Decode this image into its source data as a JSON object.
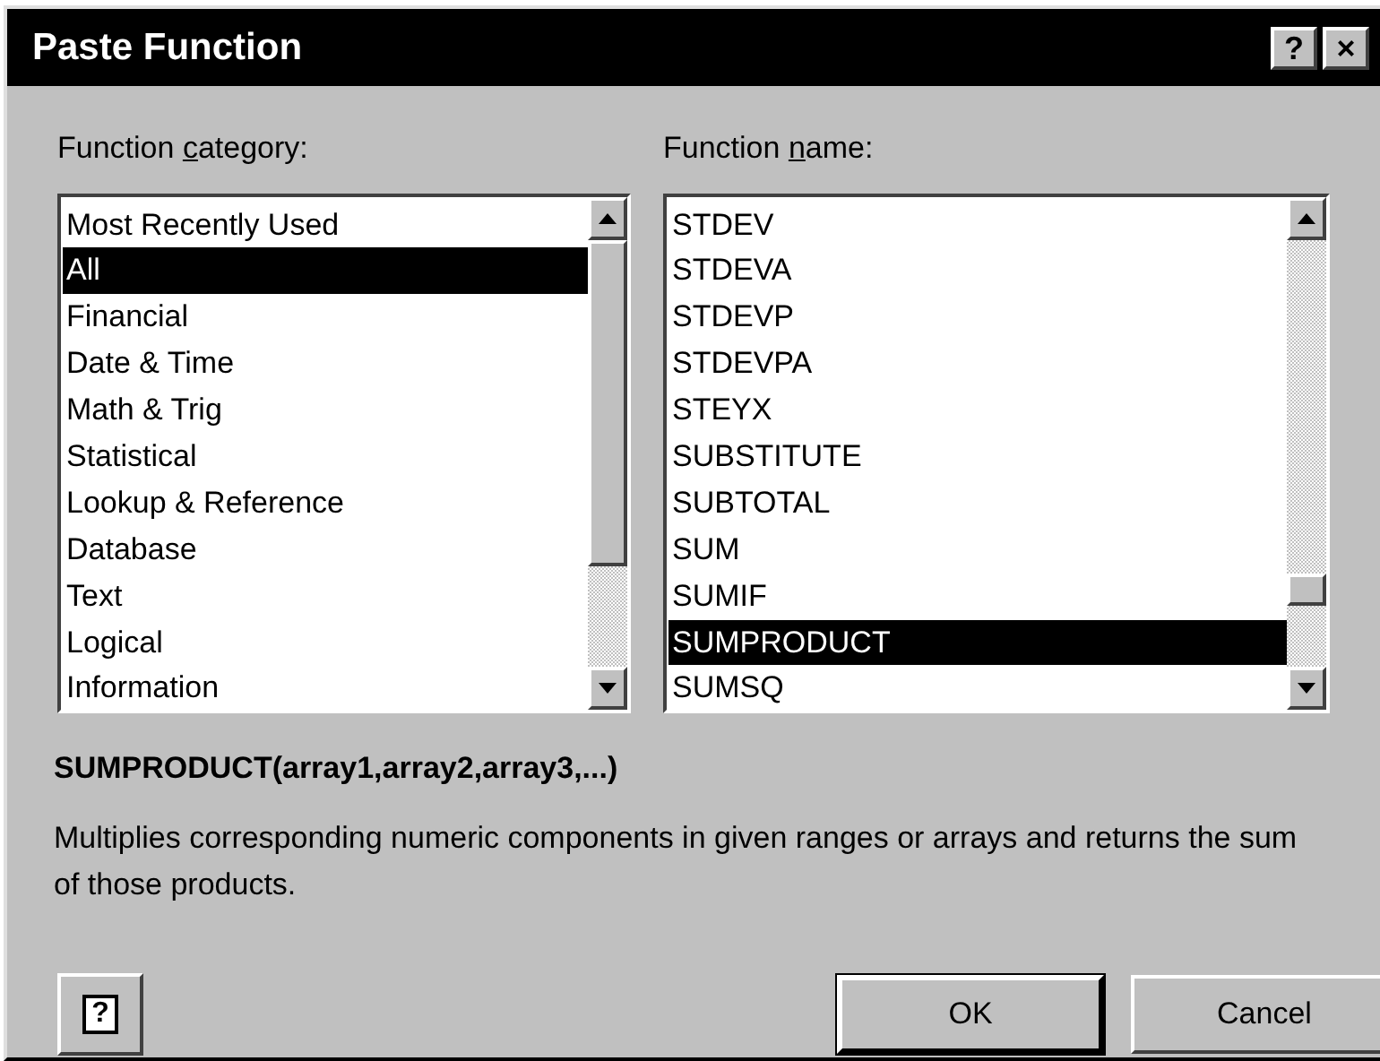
{
  "window": {
    "title": "Paste Function",
    "title_buttons": [
      "?",
      "×"
    ]
  },
  "category": {
    "label": {
      "before": "Function ",
      "access_key": "c",
      "after": "ategory:"
    },
    "items": [
      {
        "label": "Most Recently Used",
        "selected": false
      },
      {
        "label": "All",
        "selected": true
      },
      {
        "label": "Financial",
        "selected": false
      },
      {
        "label": "Date & Time",
        "selected": false
      },
      {
        "label": "Math & Trig",
        "selected": false
      },
      {
        "label": "Statistical",
        "selected": false
      },
      {
        "label": "Lookup & Reference",
        "selected": false
      },
      {
        "label": "Database",
        "selected": false
      },
      {
        "label": "Text",
        "selected": false
      },
      {
        "label": "Logical",
        "selected": false
      },
      {
        "label": "Information",
        "selected": false
      }
    ]
  },
  "function": {
    "label": {
      "before": "Function ",
      "access_key": "n",
      "after": "ame:"
    },
    "items": [
      {
        "label": "STDEV",
        "selected": false
      },
      {
        "label": "STDEVA",
        "selected": false
      },
      {
        "label": "STDEVP",
        "selected": false
      },
      {
        "label": "STDEVPA",
        "selected": false
      },
      {
        "label": "STEYX",
        "selected": false
      },
      {
        "label": "SUBSTITUTE",
        "selected": false
      },
      {
        "label": "SUBTOTAL",
        "selected": false
      },
      {
        "label": "SUM",
        "selected": false
      },
      {
        "label": "SUMIF",
        "selected": false
      },
      {
        "label": "SUMPRODUCT",
        "selected": true
      },
      {
        "label": "SUMSQ",
        "selected": false
      }
    ]
  },
  "signature": "SUMPRODUCT(array1,array2,array3,...)",
  "description": "Multiplies corresponding numeric components in given ranges or arrays and returns the sum of those products.",
  "help_button": "?",
  "buttons": [
    "OK",
    "Cancel"
  ]
}
